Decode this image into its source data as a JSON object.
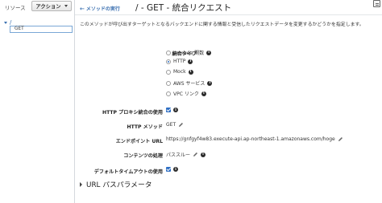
{
  "sidebar": {
    "title": "リソース",
    "action_label": "アクション",
    "tree_root": "/",
    "selected_method": "GET"
  },
  "header": {
    "back_link": "メソッドの実行",
    "title": "/ - GET - 統合リクエスト"
  },
  "description": "このメソッドが呼び出すターゲットとなるバックエンドに関する情報と受信したリクエストデータを変更するかどうかを指定します。",
  "form": {
    "integration_type_label": "統合タイプ",
    "integration_options": [
      {
        "label": "Lambda 関数",
        "selected": false
      },
      {
        "label": "HTTP",
        "selected": true
      },
      {
        "label": "Mock",
        "selected": false
      },
      {
        "label": "AWS サービス",
        "selected": false
      },
      {
        "label": "VPC リンク",
        "selected": false
      }
    ],
    "proxy_label": "HTTP プロキシ統合の使用",
    "proxy_checked": true,
    "http_method_label": "HTTP メソッド",
    "http_method_value": "GET",
    "endpoint_label": "エンドポイント URL",
    "endpoint_value": "https://gnfgyf4w83.execute-api.ap-northeast-1.amazonaws.com/hoge",
    "content_handling_label": "コンテンツの処理",
    "content_handling_value": "パススルー",
    "default_timeout_label": "デフォルトタイムアウトの使用",
    "default_timeout_checked": true
  },
  "sections": {
    "url_path_params": "URL パスパラメータ"
  },
  "colors": {
    "accent": "#2f6fc4",
    "link": "#3a6fb0"
  }
}
